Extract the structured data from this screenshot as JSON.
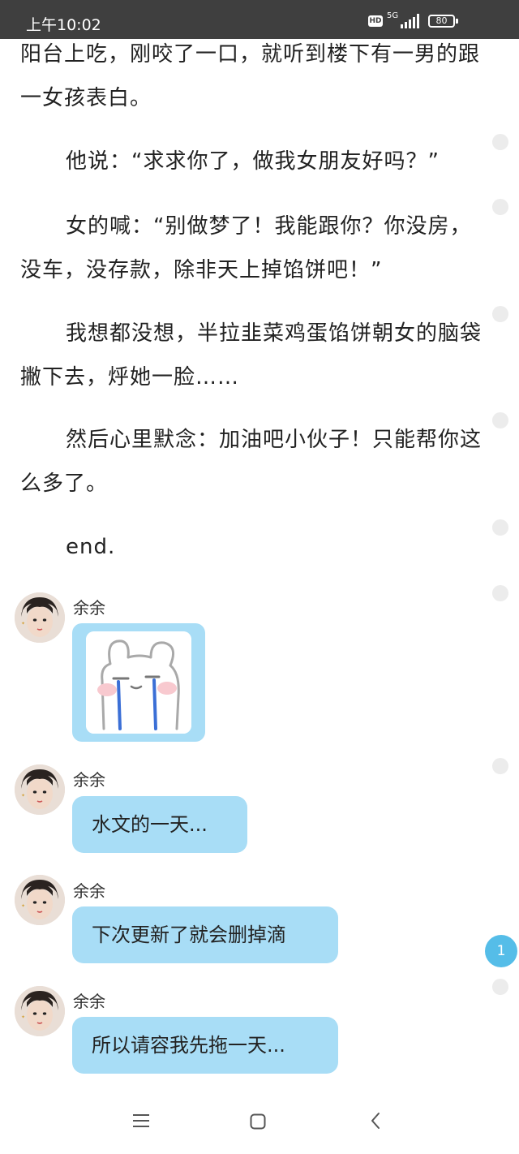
{
  "status_bar": {
    "time": "上午10:02",
    "hd_label": "HD",
    "network_label": "5G",
    "battery_level": "80"
  },
  "story": {
    "paragraphs": [
      "阳台上吃，刚咬了一口，就听到楼下有一男的跟一女孩表白。",
      "他说：“求求你了，做我女朋友好吗？”",
      "女的喊：“别做梦了！我能跟你？你没房，没车，没存款，除非天上掉馅饼吧！”",
      "我想都没想，半拉韭菜鸡蛋馅饼朝女的脑袋撇下去，烀她一脸……",
      "然后心里默念：加油吧小伙子！只能帮你这么多了。",
      "end."
    ]
  },
  "chat": {
    "messages": [
      {
        "sender": "余余",
        "type": "sticker",
        "sticker_icon": "crying-bunny-sticker"
      },
      {
        "sender": "余余",
        "type": "text",
        "text": "水文的一天..."
      },
      {
        "sender": "余余",
        "type": "text",
        "text": "下次更新了就会删掉滴"
      },
      {
        "sender": "余余",
        "type": "text",
        "text": "所以请容我先拖一天..."
      }
    ]
  },
  "side": {
    "comment_badge_count": "1"
  },
  "nav_bar": {
    "icons": [
      "menu-icon",
      "home-icon",
      "back-icon"
    ]
  },
  "colors": {
    "status_bar_bg": "#3f3f3f",
    "bubble_bg": "#a8ddf6",
    "badge_bg": "#55bde8",
    "dot_bg": "#ececec"
  }
}
